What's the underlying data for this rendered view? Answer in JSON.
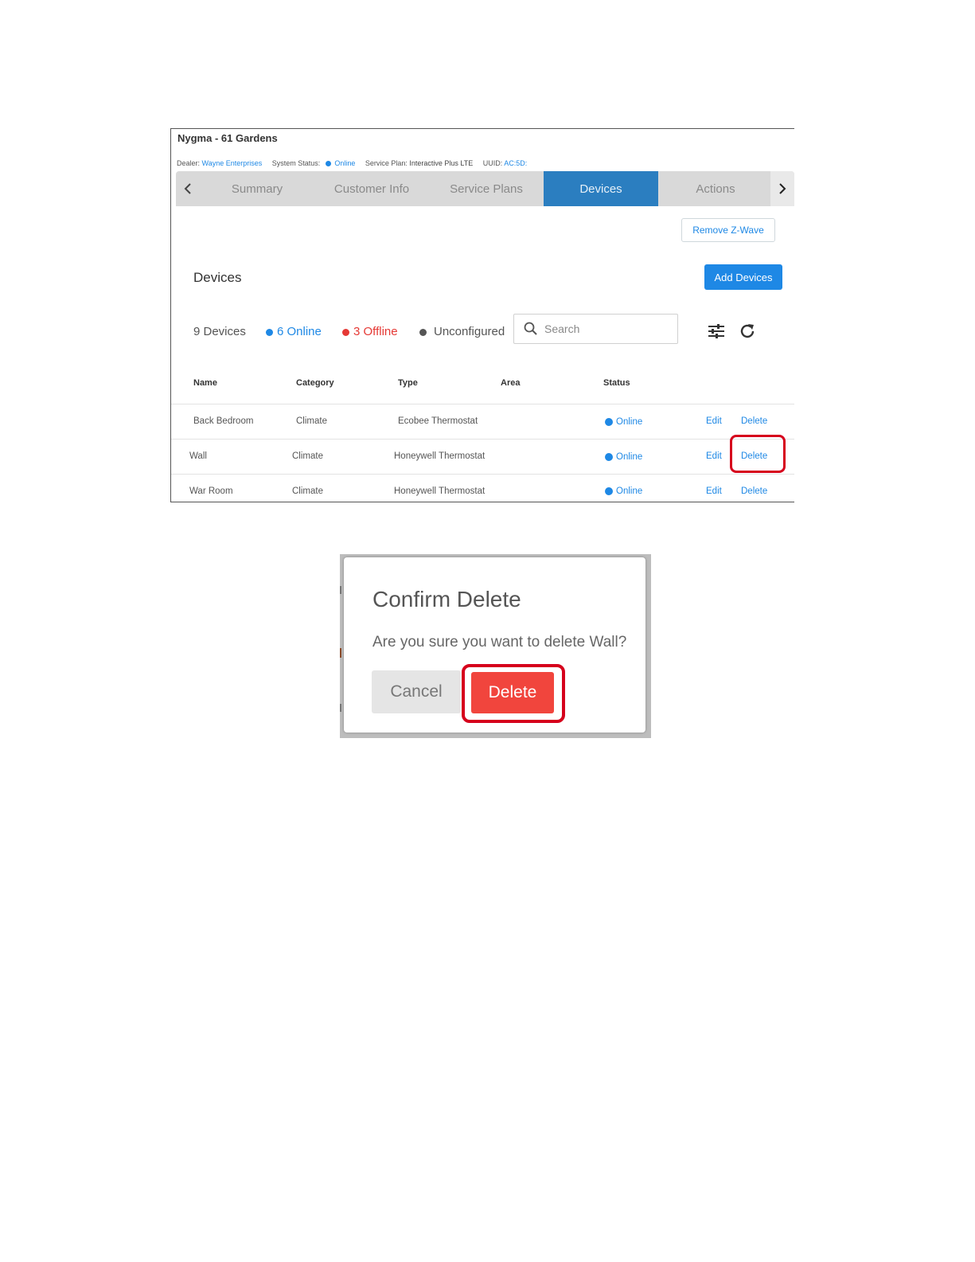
{
  "account": {
    "title": "Nygma - 61 Gardens",
    "dealer_label": "Dealer:",
    "dealer_value": "Wayne Enterprises",
    "system_status_label": "System Status:",
    "system_status_value": "Online",
    "service_plan_label": "Service Plan:",
    "service_plan_value": "Interactive Plus LTE",
    "uuid_label": "UUID:",
    "uuid_value": "AC:5D:"
  },
  "tabs": [
    {
      "label": "Summary",
      "active": false
    },
    {
      "label": "Customer Info",
      "active": false
    },
    {
      "label": "Service Plans",
      "active": false
    },
    {
      "label": "Devices",
      "active": true
    },
    {
      "label": "Actions",
      "active": false
    }
  ],
  "toolbar": {
    "remove_zwave_label": "Remove Z-Wave",
    "add_devices_label": "Add Devices"
  },
  "devices": {
    "section_title": "Devices",
    "total_label": "9 Devices",
    "online_label": "6 Online",
    "offline_label": "3 Offline",
    "unconfigured_label": "Unconfigured",
    "search_placeholder": "Search",
    "columns": [
      "Name",
      "Category",
      "Type",
      "Area",
      "Status"
    ],
    "rows": [
      {
        "name": "Back Bedroom",
        "category": "Climate",
        "type": "Ecobee Thermostat",
        "area": "",
        "status": "Online",
        "edit": "Edit",
        "delete": "Delete"
      },
      {
        "name": "Wall",
        "category": "Climate",
        "type": "Honeywell Thermostat",
        "area": "",
        "status": "Online",
        "edit": "Edit",
        "delete": "Delete"
      },
      {
        "name": "War Room",
        "category": "Climate",
        "type": "Honeywell Thermostat",
        "area": "",
        "status": "Online",
        "edit": "Edit",
        "delete": "Delete"
      }
    ]
  },
  "dialog": {
    "title": "Confirm Delete",
    "message": "Are you sure you want to delete Wall?",
    "cancel_label": "Cancel",
    "delete_label": "Delete"
  },
  "colors": {
    "accent": "#1e88e5",
    "active_tab": "#2b7ec0",
    "offline": "#e53935",
    "unconfigured": "#555555",
    "delete_button": "#f1453d",
    "highlight": "#d6001c"
  },
  "icons": [
    "chevron-left-icon",
    "chevron-right-icon",
    "search-icon",
    "filter-sliders-icon",
    "refresh-icon",
    "status-dot-icon"
  ]
}
